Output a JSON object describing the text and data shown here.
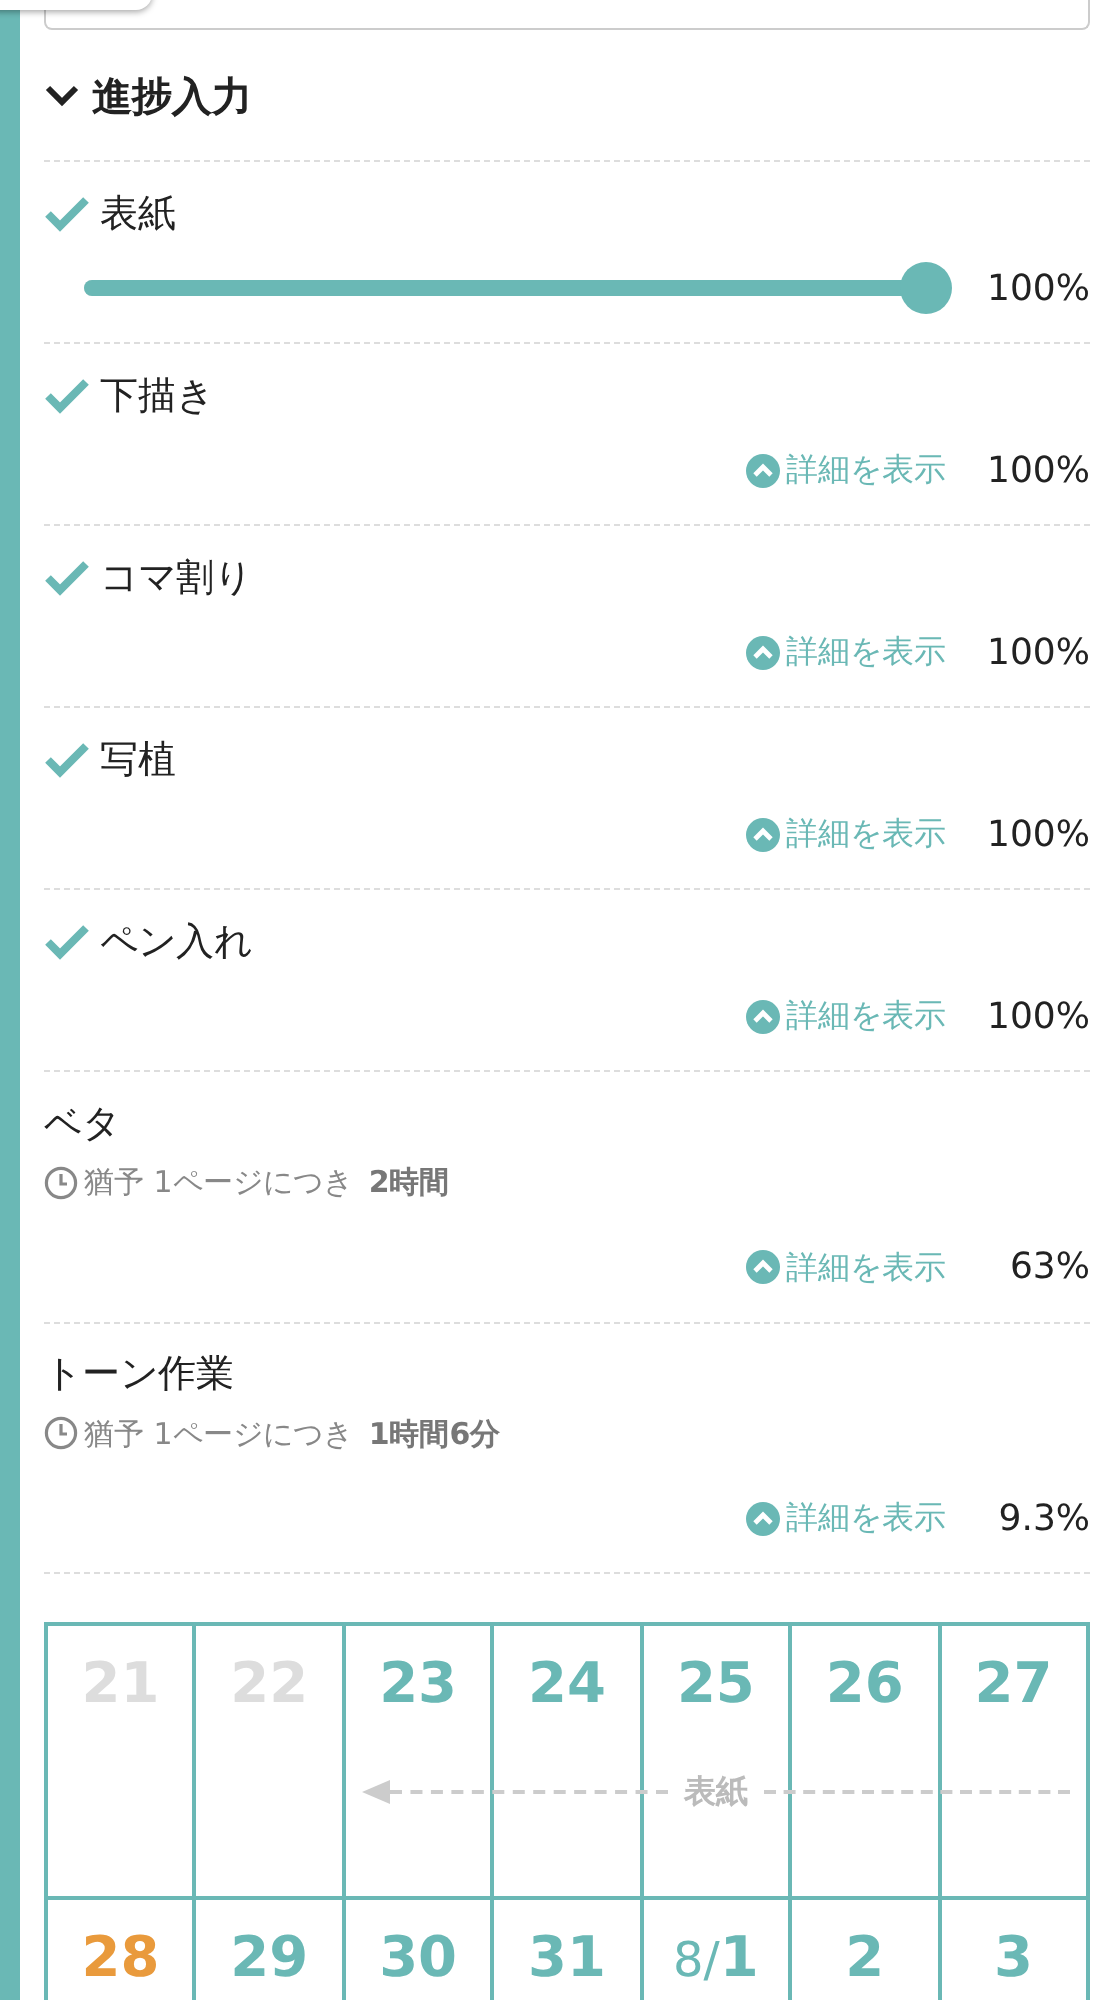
{
  "section": {
    "title": "進捗入力",
    "expanded": true
  },
  "tasks": [
    {
      "kind": "slider",
      "name": "表紙",
      "done": true,
      "level": 1,
      "reading": "100%"
    },
    {
      "kind": "detail",
      "name": "下描き",
      "done": true,
      "link": "詳細を表示",
      "reading": "100%"
    },
    {
      "kind": "detail",
      "name": "コマ割り",
      "done": true,
      "link": "詳細を表示",
      "reading": "100%"
    },
    {
      "kind": "detail",
      "name": "写植",
      "done": true,
      "link": "詳細を表示",
      "reading": "100%"
    },
    {
      "kind": "detail",
      "name": "ペン入れ",
      "done": true,
      "link": "詳細を表示",
      "reading": "100%"
    },
    {
      "kind": "detail",
      "name": "ベタ",
      "done": false,
      "grace_label": "猶予 1ページにつき",
      "grace_value": "2時間",
      "link": "詳細を表示",
      "reading": "63%"
    },
    {
      "kind": "detail",
      "name": "トーン作業",
      "done": false,
      "grace_label": "猶予 1ページにつき",
      "grace_value": "1時間6分",
      "link": "詳細を表示",
      "reading": "9.3%"
    }
  ],
  "calendar": {
    "weeks": [
      {
        "bar_label": "表紙",
        "days": [
          {
            "day": "21",
            "past": true,
            "today": false,
            "in_bar": false
          },
          {
            "day": "22",
            "past": true,
            "today": false,
            "in_bar": false
          },
          {
            "day": "23",
            "past": false,
            "today": false,
            "in_bar": true
          },
          {
            "day": "24",
            "past": false,
            "today": false,
            "in_bar": true
          },
          {
            "day": "25",
            "past": false,
            "today": false,
            "in_bar": true
          },
          {
            "day": "26",
            "past": false,
            "today": false,
            "in_bar": true
          },
          {
            "day": "27",
            "past": false,
            "today": false,
            "in_bar": true
          }
        ]
      },
      {
        "days": [
          {
            "day": "28",
            "past": false,
            "today": true
          },
          {
            "day": "29",
            "past": false,
            "today": false
          },
          {
            "day": "30",
            "past": false,
            "today": false
          },
          {
            "day": "31",
            "past": false,
            "today": false
          },
          {
            "month": "8/",
            "day": "1",
            "past": false,
            "today": false
          },
          {
            "day": "2",
            "past": false,
            "today": false
          },
          {
            "day": "3",
            "past": false,
            "today": false
          }
        ]
      }
    ]
  }
}
